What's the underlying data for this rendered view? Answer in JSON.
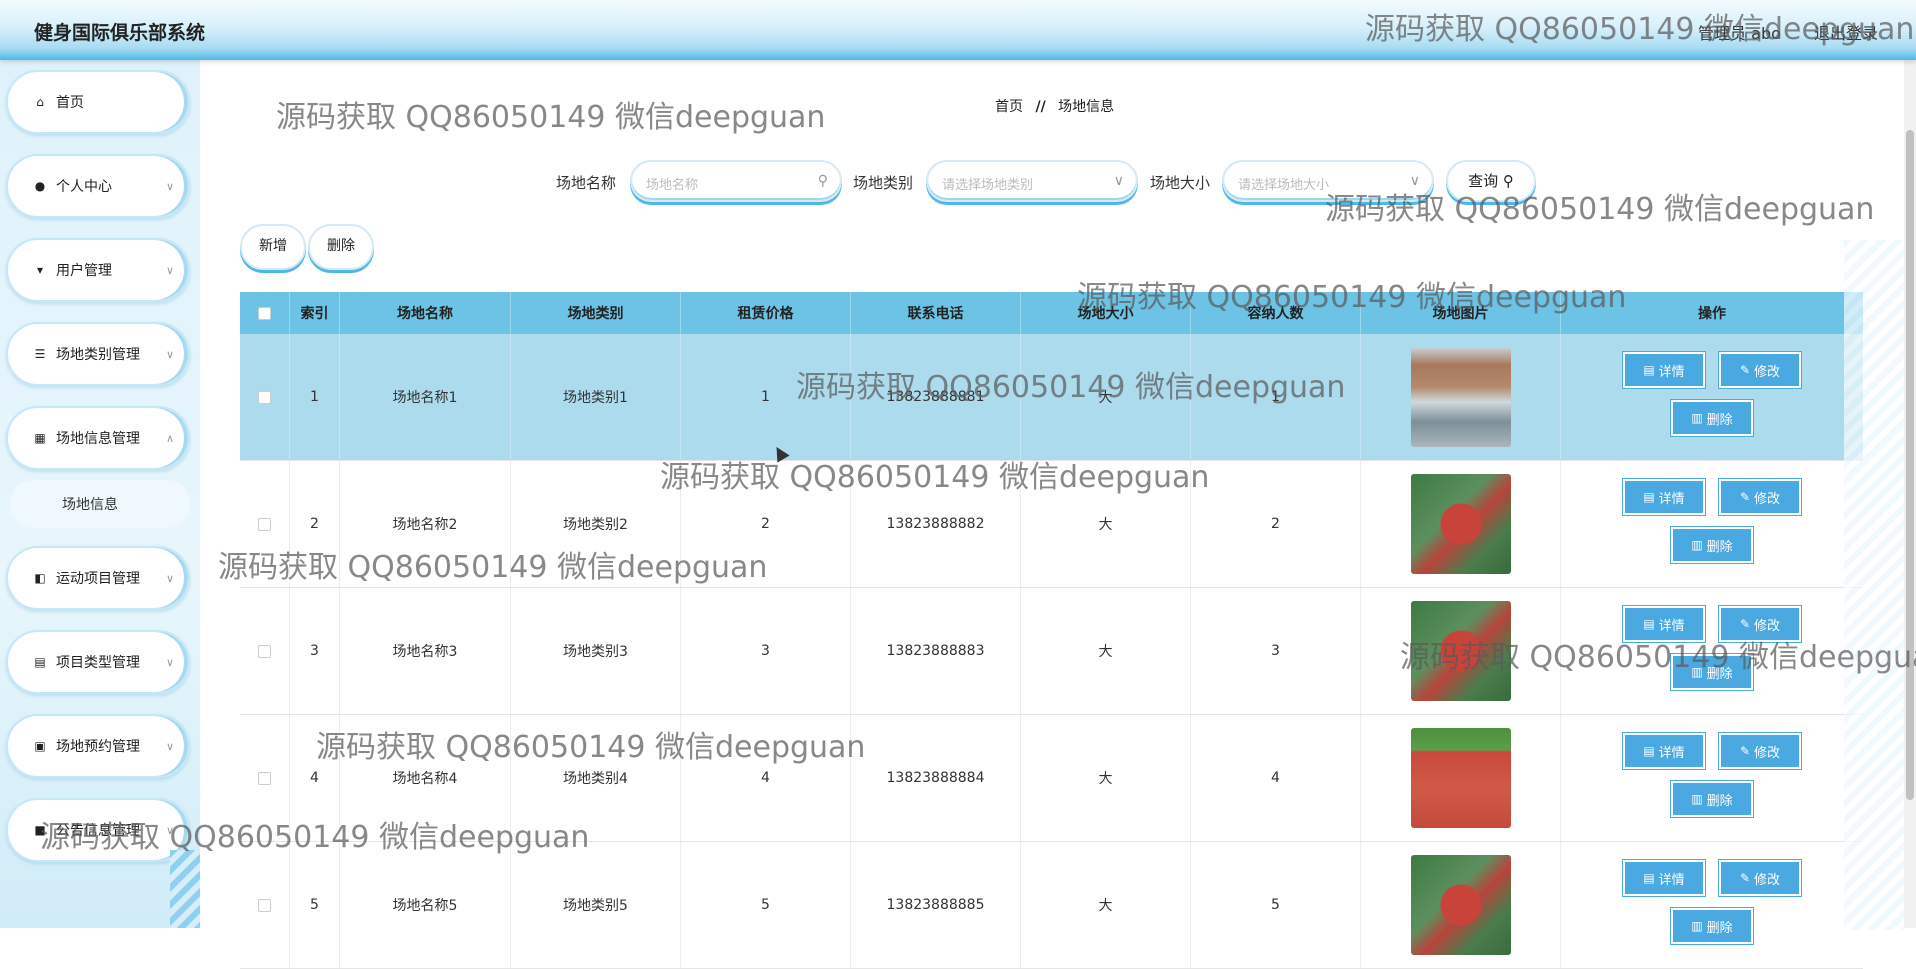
{
  "app": {
    "title": "健身国际俱乐部系统"
  },
  "header": {
    "user": "管理员 abo",
    "logout": "退出登录"
  },
  "sidebar": {
    "items": [
      {
        "label": "首页",
        "icon": "home-icon"
      },
      {
        "label": "个人中心",
        "icon": "user-icon"
      },
      {
        "label": "用户管理",
        "icon": "users-icon"
      },
      {
        "label": "场地类别管理",
        "icon": "list-icon"
      },
      {
        "label": "场地信息管理",
        "icon": "grid-icon"
      },
      {
        "label": "运动项目管理",
        "icon": "sport-icon"
      },
      {
        "label": "项目类型管理",
        "icon": "doc-icon"
      },
      {
        "label": "场地预约管理",
        "icon": "briefcase-icon"
      },
      {
        "label": "公告信息管理",
        "icon": "notice-icon"
      }
    ],
    "sub_item": "场地信息"
  },
  "breadcrumb": {
    "home": "首页",
    "sep": "//",
    "current": "场地信息"
  },
  "search": {
    "name_label": "场地名称",
    "name_placeholder": "场地名称",
    "type_label": "场地类别",
    "type_placeholder": "请选择场地类别",
    "size_label": "场地大小",
    "size_placeholder": "请选择场地大小",
    "query_label": "查询"
  },
  "actions": {
    "add": "新增",
    "delete": "删除"
  },
  "table": {
    "headers": [
      "索引",
      "场地名称",
      "场地类别",
      "租赁价格",
      "联系电话",
      "场地大小",
      "容纳人数",
      "场地图片",
      "操作"
    ],
    "rows": [
      {
        "index": "1",
        "name": "场地名称1",
        "type": "场地类别1",
        "price": "1",
        "phone": "13823888881",
        "size": "大",
        "capacity": "1",
        "image": "building-court"
      },
      {
        "index": "2",
        "name": "场地名称2",
        "type": "场地类别2",
        "price": "2",
        "phone": "13823888882",
        "size": "大",
        "capacity": "2",
        "image": "red-letters-field"
      },
      {
        "index": "3",
        "name": "场地名称3",
        "type": "场地类别3",
        "price": "3",
        "phone": "13823888883",
        "size": "大",
        "capacity": "3",
        "image": "red-letters-field"
      },
      {
        "index": "4",
        "name": "场地名称4",
        "type": "场地类别4",
        "price": "4",
        "phone": "13823888884",
        "size": "大",
        "capacity": "4",
        "image": "running-track"
      },
      {
        "index": "5",
        "name": "场地名称5",
        "type": "场地类别5",
        "price": "5",
        "phone": "13823888885",
        "size": "大",
        "capacity": "5",
        "image": "red-letters-field"
      }
    ],
    "op_detail": "详情",
    "op_edit": "修改",
    "op_delete": "删除"
  },
  "watermark": "源码获取 QQ86050149 微信deepguan",
  "colors": {
    "accent": "#4fb7e6",
    "header_row": "#6cc3e6",
    "highlight_row": "#acdbee",
    "op_button": "#4aa9e0"
  }
}
